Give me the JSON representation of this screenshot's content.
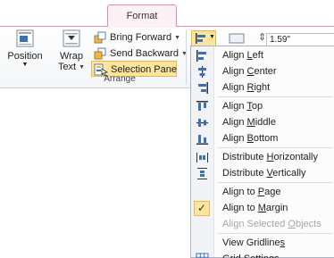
{
  "ribbon": {
    "tab_label": "Format",
    "group_label": "Arrange",
    "position_label": "Position",
    "wrap_label_line1": "Wrap",
    "wrap_label_line2": "Text",
    "bring_forward": "Bring Forward",
    "send_backward": "Send Backward",
    "selection_pane": "Selection Pane",
    "size_value": "1.59\""
  },
  "menu": {
    "items": [
      {
        "pre": "Align ",
        "key": "L",
        "post": "eft",
        "icon": "align-left-icon"
      },
      {
        "pre": "Align ",
        "key": "C",
        "post": "enter",
        "icon": "align-center-icon"
      },
      {
        "pre": "Align ",
        "key": "R",
        "post": "ight",
        "icon": "align-right-icon"
      },
      {
        "pre": "Align ",
        "key": "T",
        "post": "op",
        "icon": "align-top-icon"
      },
      {
        "pre": "Align ",
        "key": "M",
        "post": "iddle",
        "icon": "align-middle-icon"
      },
      {
        "pre": "Align ",
        "key": "B",
        "post": "ottom",
        "icon": "align-bottom-icon"
      },
      {
        "pre": "Distribute ",
        "key": "H",
        "post": "orizontally",
        "icon": "distribute-horizontally-icon"
      },
      {
        "pre": "Distribute ",
        "key": "V",
        "post": "ertically",
        "icon": "distribute-vertically-icon"
      },
      {
        "pre": "Align to ",
        "key": "P",
        "post": "age"
      },
      {
        "pre": "Align to ",
        "key": "M",
        "post": "argin",
        "checked": true
      },
      {
        "pre": "Align Selected ",
        "key": "O",
        "post": "bjects",
        "disabled": true
      },
      {
        "pre": "View Gridline",
        "key": "s",
        "post": ""
      },
      {
        "pre": "",
        "key": "G",
        "post": "rid Settings...",
        "icon": "grid-icon"
      }
    ]
  }
}
